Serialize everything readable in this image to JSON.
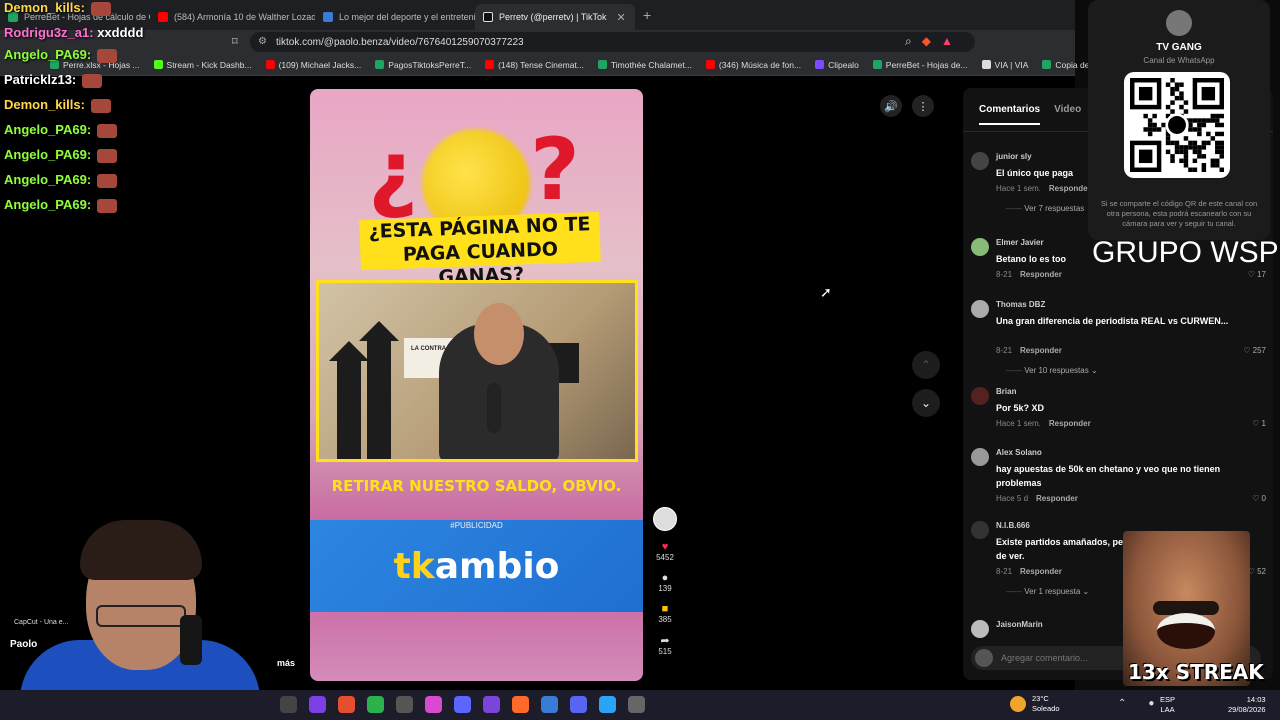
{
  "browser": {
    "tabs": [
      {
        "label": "PerreBet - Hojas de cálculo de Goo",
        "color": "#1fa463",
        "active": false
      },
      {
        "label": "(584) Armonía 10 de Walther Lozada",
        "color": "#ff0000",
        "active": false
      },
      {
        "label": "Lo mejor del deporte y el entretenim",
        "color": "#3a7bd5",
        "active": false
      },
      {
        "label": "Perretv (@perretv) | TikTok",
        "color": "#111111",
        "active": true
      }
    ],
    "new_tab": "+",
    "url": "tiktok.com/@paolo.benza/video/7676401259070377223",
    "bookmarks": [
      {
        "label": "Perre.xlsx - Hojas ...",
        "color": "#1fa463"
      },
      {
        "label": "Stream - Kick Dashb...",
        "color": "#53fc18"
      },
      {
        "label": "(109) Michael Jacks...",
        "color": "#ff0000"
      },
      {
        "label": "PagosTiktoksPerreT...",
        "color": "#1fa463"
      },
      {
        "label": "(148) Tense Cinemat...",
        "color": "#ff0000"
      },
      {
        "label": "Timothée Chalamet...",
        "color": "#1fa463"
      },
      {
        "label": "(346) Música de fon...",
        "color": "#ff0000"
      },
      {
        "label": "Clipealo",
        "color": "#7b4bff"
      },
      {
        "label": "PerreBet - Hojas de...",
        "color": "#1fa463"
      },
      {
        "label": "VIA | VIA",
        "color": "#dddddd"
      },
      {
        "label": "Copia de Perre .xlsx...",
        "color": "#1fa463"
      }
    ]
  },
  "video": {
    "q_open": "¿",
    "q_close": "?",
    "headline": "¿ESTA PÁGINA NO TE PAGA CUANDO GANAS?",
    "screen_label": "LA CONTRA",
    "caption": "RETIRAR NUESTRO SALDO, OBVIO.",
    "ad_tag": "#PUBLICIDAD",
    "brand_tk": "tk",
    "brand_rest": "ambio"
  },
  "actions": {
    "likes": "5452",
    "comments": "139",
    "saves": "385",
    "shares": "515"
  },
  "comments_panel": {
    "tabs": [
      "Comentarios",
      "Video"
    ],
    "items": [
      {
        "name": "junior sly",
        "text": "El único que paga",
        "meta": "Hace 1 sem.",
        "reply": "Responder",
        "likes": "",
        "more": "Ver 7 respuestas"
      },
      {
        "name": "Elmer Javier",
        "text": "Betano lo es too",
        "meta": "8-21",
        "reply": "Responder",
        "likes": "17",
        "more": ""
      },
      {
        "name": "Thomas DBZ",
        "text": "Una gran diferencia de periodista REAL vs CURWEN...",
        "meta": "8-21",
        "reply": "Responder",
        "likes": "257",
        "more": "Ver 10 respuestas"
      },
      {
        "name": "Brian",
        "text": "Por 5k? XD",
        "meta": "Hace 1 sem.",
        "reply": "Responder",
        "likes": "1",
        "more": ""
      },
      {
        "name": "Alex Solano",
        "text": "hay apuestas de 50k en chetano y veo que no tienen problemas",
        "meta": "Hace 5 d",
        "reply": "Responder",
        "likes": "0",
        "more": ""
      },
      {
        "name": "N.I.B.666",
        "text": "Existe partidos amañados, pe",
        "text2": "de ver.",
        "meta": "8-21",
        "reply": "Responder",
        "likes": "52",
        "more": "Ver 1 respuesta"
      },
      {
        "name": "JaisonMarin",
        "text": "",
        "meta": "",
        "reply": "",
        "likes": "",
        "more": ""
      }
    ],
    "add_placeholder": "Agregar comentario..."
  },
  "chat": [
    {
      "user": "Demon_kills:",
      "text": "",
      "cls": "gold"
    },
    {
      "user": "Rodrigu3z_a1:",
      "text": "xxdddd",
      "cls": "pink"
    },
    {
      "user": "Angelo_PA69:",
      "text": "",
      "cls": ""
    },
    {
      "user": "Patricklz13:",
      "text": "",
      "cls": "white"
    },
    {
      "user": "Demon_kills:",
      "text": "",
      "cls": "gold"
    },
    {
      "user": "Angelo_PA69:",
      "text": "",
      "cls": ""
    },
    {
      "user": "Angelo_PA69:",
      "text": "",
      "cls": ""
    },
    {
      "user": "Angelo_PA69:",
      "text": "",
      "cls": ""
    },
    {
      "user": "Angelo_PA69:",
      "text": "",
      "cls": ""
    }
  ],
  "qr_card": {
    "title": "TV GANG",
    "subtitle": "Canal de WhatsApp",
    "note": "Si se comparte el código QR de este canal con otra persona, esta podrá escanearlo con su cámara para ver y seguir tu canal."
  },
  "overlay": {
    "grupo": "GRUPO WSP",
    "streak": "13x STREAK",
    "capcut": "CapCut - Una e...",
    "paolo": "Paolo",
    "mas": "más"
  },
  "taskbar": {
    "temp": "23°C",
    "weather": "Soleado",
    "lang1": "ESP",
    "lang2": "LAA",
    "time": "14:03",
    "date": "29/08/2026"
  }
}
